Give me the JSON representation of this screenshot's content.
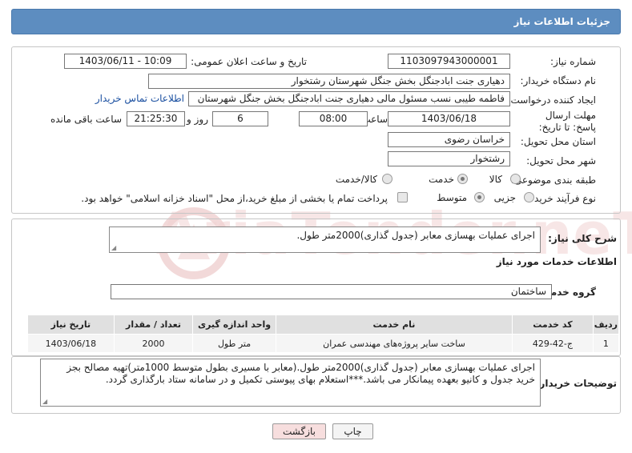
{
  "page": {
    "title": "جزئیات اطلاعات نیاز"
  },
  "watermark": {
    "text": "AriaTender.neT"
  },
  "form": {
    "need_number_label": "شماره نیاز:",
    "need_number": "1103097943000001",
    "announce_label": "تاریخ و ساعت اعلان عمومی:",
    "announce_value": "1403/06/11 - 10:09",
    "buyer_label": "نام دستگاه خریدار:",
    "buyer": "دهیاری جنت ابادجنگل بخش جنگل شهرستان رشتخوار",
    "creator_label": "ایجاد کننده درخواست:",
    "creator": "فاطمه طیبی نسب مسئول مالی دهیاری جنت ابادجنگل بخش جنگل شهرستان",
    "contact_link": "اطلاعات تماس خریدار",
    "deadline_label": "مهلت ارسال پاسخ: تا تاریخ:",
    "deadline_date": "1403/06/18",
    "time_label": "ساعت",
    "deadline_time": "08:00",
    "days_value": "6",
    "days_label": "روز و",
    "remaining_time": "21:25:30",
    "remaining_label": "ساعت باقی مانده",
    "province_label": "استان محل تحویل:",
    "province": "خراسان رضوی",
    "city_label": "شهر محل تحویل:",
    "city": "رشتخوار",
    "category_label": "طبقه بندی موضوعی:",
    "category_options": [
      "کالا",
      "خدمت",
      "کالا/خدمت"
    ],
    "category_selected": "خدمت",
    "process_label": "نوع فرآیند خرید :",
    "process_options": [
      "جزیی",
      "متوسط"
    ],
    "process_selected": "متوسط",
    "payment_note": "پرداخت تمام یا بخشی از مبلغ خرید،از محل \"اسناد خزانه اسلامی\" خواهد بود."
  },
  "summary": {
    "label": "شرح کلی نیاز:",
    "text": "اجرای عملیات بهسازی معابر (جدول گذاری)2000متر طول."
  },
  "services": {
    "section_title": "اطلاعات خدمات مورد نیاز",
    "group_label": "گروه خدمت:",
    "group_value": "ساختمان",
    "columns": [
      "ردیف",
      "کد خدمت",
      "نام خدمت",
      "واحد اندازه گیری",
      "تعداد / مقدار",
      "تاریخ نیاز"
    ],
    "rows": [
      [
        "1",
        "ج-42-429",
        "ساخت سایر پروژه‌های مهندسی عمران",
        "متر طول",
        "2000",
        "1403/06/18"
      ]
    ]
  },
  "buyer_notes": {
    "label": "توضیحات خریدار:",
    "text": "اجرای عملیات بهسازی معابر (جدول گذاری)2000متر طول.(معابر با مسیری بطول متوسط 1000متر)تهیه مصالح بجز خرید جدول و کانیو بعهده پیمانکار می باشد.***استعلام بهای پیوستی تکمیل و در سامانه ستاد بارگذاری گردد."
  },
  "buttons": {
    "print": "چاپ",
    "back": "بازگشت"
  },
  "colors": {
    "header": "#5d8dc0",
    "back_button": "#f7dede",
    "link": "#1a4fa0"
  }
}
